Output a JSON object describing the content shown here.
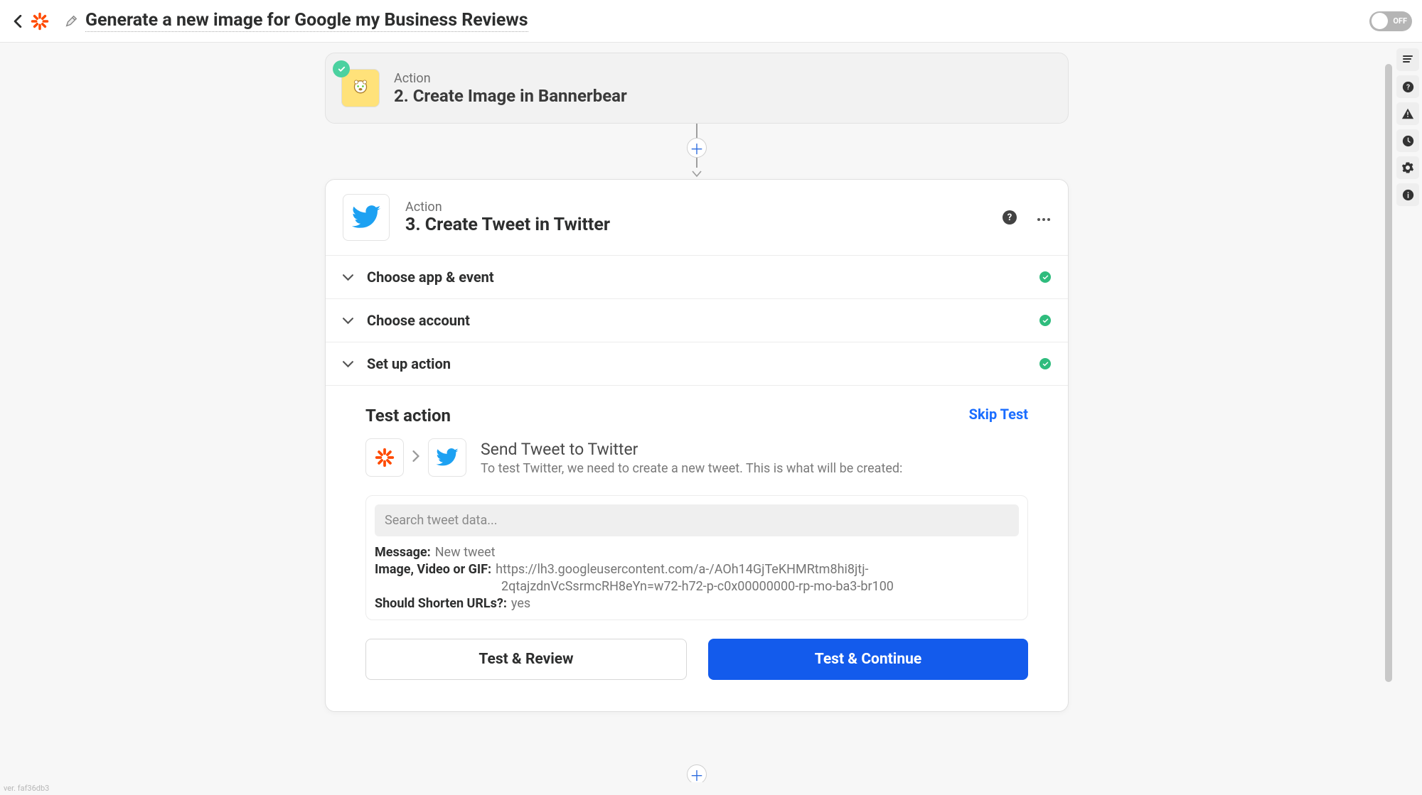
{
  "header": {
    "title": "Generate a new image for Google my Business Reviews",
    "toggle_label": "OFF"
  },
  "step2": {
    "label": "Action",
    "title": "2. Create Image in Bannerbear"
  },
  "step3": {
    "label": "Action",
    "title": "3. Create Tweet in Twitter",
    "rows": {
      "choose_app": "Choose app & event",
      "choose_account": "Choose account",
      "set_up_action": "Set up action"
    },
    "test": {
      "title": "Test action",
      "skip": "Skip Test",
      "send_title": "Send Tweet to Twitter",
      "send_desc": "To test Twitter, we need to create a new tweet. This is what will be created:",
      "search_placeholder": "Search tweet data...",
      "fields": {
        "message_label": "Message:",
        "message_value": "New tweet",
        "image_label": "Image, Video or GIF:",
        "image_value_line1": "https://lh3.googleusercontent.com/a-/AOh14GjTeKHMRtm8hi8jtj-",
        "image_value_line2": "2qtajzdnVcSsrmcRH8eYn=w72-h72-p-c0x00000000-rp-mo-ba3-br100",
        "shorten_label": "Should Shorten URLs?:",
        "shorten_value": "yes"
      },
      "buttons": {
        "review": "Test & Review",
        "continue": "Test & Continue"
      }
    }
  },
  "footer": {
    "version": "ver. faf36db3"
  }
}
